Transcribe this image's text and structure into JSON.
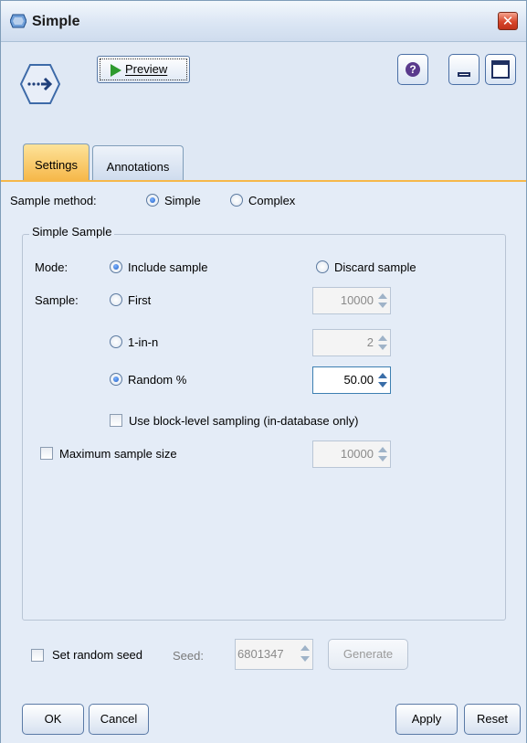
{
  "window": {
    "title": "Simple"
  },
  "toolbar": {
    "preview_label": "Preview",
    "help_label": "?"
  },
  "tabs": [
    {
      "label": "Settings",
      "active": true
    },
    {
      "label": "Annotations",
      "active": false
    }
  ],
  "settings": {
    "sample_method_label": "Sample method:",
    "sample_method_options": [
      "Simple",
      "Complex"
    ],
    "sample_method_selected": "Simple",
    "group_title": "Simple Sample",
    "mode_label": "Mode:",
    "mode_options": [
      "Include sample",
      "Discard sample"
    ],
    "mode_selected": "Include sample",
    "sample_label": "Sample:",
    "sample_options": [
      {
        "label": "First",
        "value": "10000",
        "selected": false
      },
      {
        "label": "1-in-n",
        "value": "2",
        "selected": false
      },
      {
        "label": "Random %",
        "value": "50.00",
        "selected": true
      }
    ],
    "block_level_label": "Use block-level sampling (in-database only)",
    "block_level_checked": false,
    "max_sample_label": "Maximum sample size",
    "max_sample_checked": false,
    "max_sample_value": "10000",
    "random_seed_label": "Set random seed",
    "random_seed_checked": false,
    "seed_label": "Seed:",
    "seed_value": "6801347",
    "generate_label": "Generate"
  },
  "footer": {
    "ok_label": "OK",
    "cancel_label": "Cancel",
    "apply_label": "Apply",
    "reset_label": "Reset"
  },
  "colors": {
    "active_tab": "#f6b84a",
    "accent_blue": "#1f5fc7",
    "close_red": "#d7452a"
  }
}
